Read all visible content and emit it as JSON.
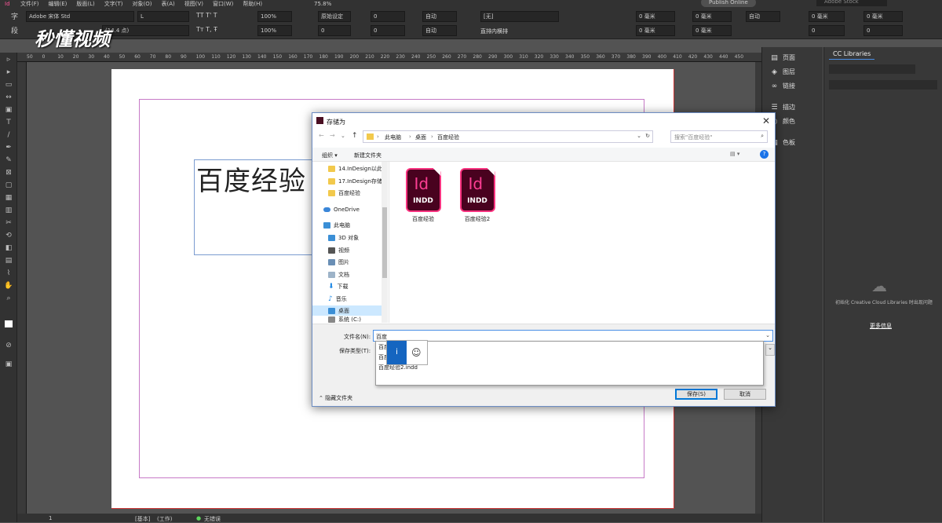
{
  "menubar": {
    "items": [
      "Id",
      "文件(F)",
      "编辑(E)",
      "版面(L)",
      "文字(T)",
      "对象(O)",
      "表(A)",
      "视图(V)",
      "窗口(W)",
      "帮助(H)"
    ],
    "zoom": "75.8%",
    "publish": "Publish Online",
    "stock_placeholder": "Adobe Stock"
  },
  "control": {
    "font_family": "Adobe 宋体 Std",
    "font_style": "L",
    "font_size_tag": "(14.4 点)",
    "scale_h": "100%",
    "scale_v": "100%",
    "kerning": "原始设定",
    "tracking": "0",
    "baseline": "0",
    "skew": "0°",
    "leading_auto": "自动",
    "leading_auto2": "自动",
    "lang": "[无]",
    "wrap_label": "直排内横排",
    "mm1": "0 毫米",
    "mm2": "0 毫米",
    "mm3": "0 毫米",
    "mm4": "0 毫米",
    "auto3": "自动"
  },
  "ruler_ticks": [
    "50",
    "0",
    "10",
    "20",
    "30",
    "40",
    "50",
    "60",
    "70",
    "80",
    "90",
    "100",
    "110",
    "120",
    "130",
    "140",
    "150",
    "160",
    "170",
    "180",
    "190",
    "200",
    "210",
    "220",
    "230",
    "240",
    "250",
    "260",
    "270",
    "280",
    "290",
    "300",
    "310",
    "320",
    "330",
    "340",
    "350",
    "360",
    "370",
    "380",
    "390",
    "400",
    "410",
    "420",
    "430",
    "440",
    "450"
  ],
  "document": {
    "text": "百度经验"
  },
  "status": {
    "page": "1",
    "basic": "[基本]",
    "work": "(工作)",
    "errors": "无错误"
  },
  "panel1": {
    "items": [
      "页面",
      "图层",
      "链接",
      "描边",
      "颜色",
      "色板"
    ]
  },
  "panel2": {
    "tab": "CC Libraries",
    "message": "初始化 Creative Cloud Libraries 时出现问题",
    "more_info": "更多信息"
  },
  "dialog": {
    "title": "存储为",
    "breadcrumb": [
      "此电脑",
      "桌面",
      "百度经验"
    ],
    "search_placeholder": "搜索\"百度经验\"",
    "organize": "组织 ▾",
    "new_folder": "新建文件夹",
    "nav": {
      "folder1": "14.InDesign以此",
      "folder2": "17.InDesign存储",
      "folder3": "百度经验",
      "onedrive": "OneDrive",
      "pc": "此电脑",
      "obj3d": "3D 对象",
      "video": "视频",
      "pictures": "图片",
      "docs": "文档",
      "downloads": "下载",
      "music": "音乐",
      "desktop": "桌面",
      "system": "系统 (C:)"
    },
    "files": [
      {
        "name": "百度经验",
        "badge": "Id",
        "ext": "INDD"
      },
      {
        "name": "百度经验2",
        "badge": "Id",
        "ext": "INDD"
      }
    ],
    "filename_label": "文件名(N):",
    "filename_value": "百度",
    "filetype_label": "保存类型(T):",
    "autocomplete": [
      "百度",
      "百度",
      "百度经验2.indd"
    ],
    "ime_label": "i",
    "hide_folders": "隐藏文件夹",
    "save_button": "保存(S)",
    "cancel_button": "取消"
  },
  "watermark": "秒懂视频"
}
